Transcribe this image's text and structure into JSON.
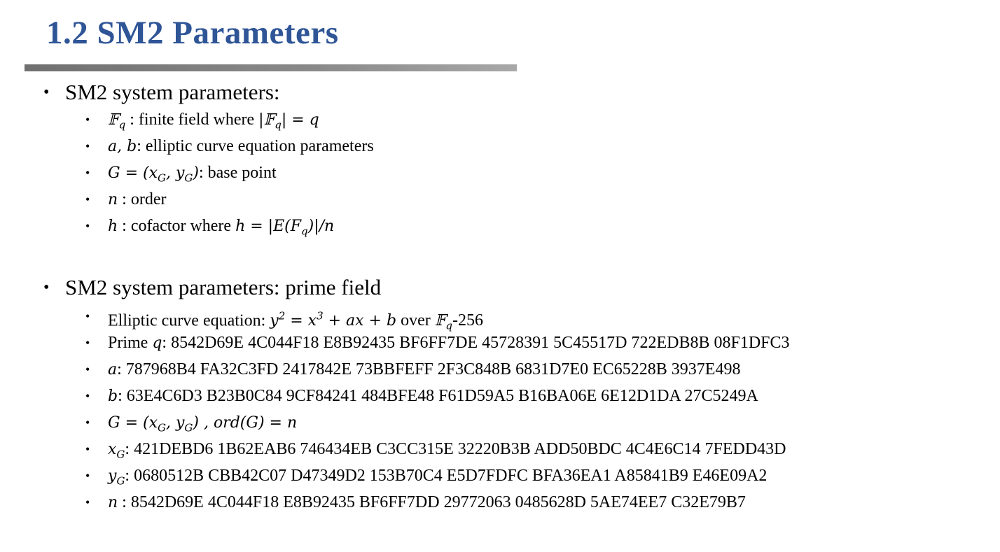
{
  "slide": {
    "title": "1.2  SM2 Parameters"
  },
  "section1": {
    "heading": "SM2 system parameters:",
    "items": [
      {
        "math_html": "𝔽<sub>q</sub>",
        "text": " : finite field where ",
        "math2_html": "|𝔽<sub>q</sub>| = q"
      },
      {
        "math_html": "a, b",
        "text": ": elliptic curve equation parameters"
      },
      {
        "math_html": "G = (x<sub>G</sub>, y<sub>G</sub>)",
        "text": ": base point"
      },
      {
        "math_html": "n",
        "text": " : order"
      },
      {
        "math_html": "h",
        "text": " :  cofactor where ",
        "math2_html": "h = |E(F<sub>q</sub>)|/n"
      }
    ]
  },
  "section2": {
    "heading": "SM2 system parameters: prime field",
    "items": [
      {
        "label": "Elliptic curve equation: ",
        "math_html": "y<sup>2</sup> = x<sup>3</sup> + ax + b",
        "suffix_html": " over <span class=\"math\">𝔽<sub>q</sub></span>-256"
      },
      {
        "label": "Prime ",
        "math_html": "q",
        "value": ": 8542D69E 4C044F18 E8B92435 BF6FF7DE 45728391 5C45517D 722EDB8B 08F1DFC3"
      },
      {
        "math_html": "a",
        "value": ": 787968B4 FA32C3FD 2417842E 73BBFEFF 2F3C848B 6831D7E0 EC65228B 3937E498"
      },
      {
        "math_html": "b",
        "value": ": 63E4C6D3 B23B0C84 9CF84241 484BFE48 F61D59A5 B16BA06E 6E12D1DA 27C5249A"
      },
      {
        "math_html": "G = (x<sub>G</sub>, y<sub>G</sub>) , ord(G) = n"
      },
      {
        "math_html": "x<sub>G</sub>",
        "value": ": 421DEBD6 1B62EAB6 746434EB C3CC315E 32220B3B ADD50BDC 4C4E6C14 7FEDD43D"
      },
      {
        "math_html": "y<sub>G</sub>",
        "value": ": 0680512B CBB42C07 D47349D2 153B70C4 E5D7FDFC BFA36EA1 A85841B9 E46E09A2"
      },
      {
        "math_html": "n",
        "value": " : 8542D69E 4C044F18 E8B92435 BF6FF7DD 29772063 0485628D 5AE74EE7 C32E79B7"
      }
    ]
  },
  "bullets": {
    "main": "•",
    "sub": "•"
  }
}
